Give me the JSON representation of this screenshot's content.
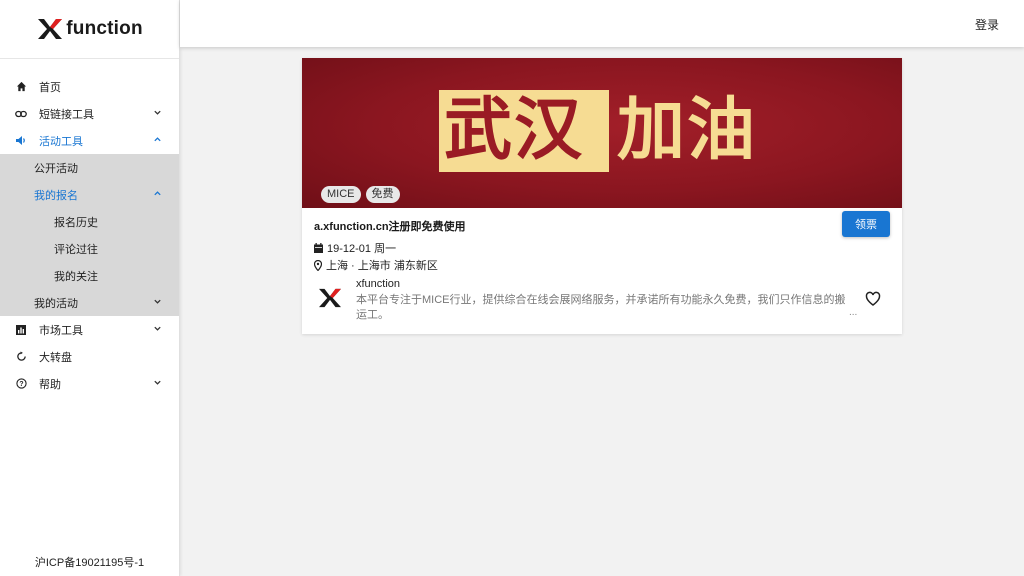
{
  "brand": {
    "name": "function"
  },
  "header": {
    "login": "登录"
  },
  "sidebar": {
    "items": [
      {
        "label": "首页"
      },
      {
        "label": "短链接工具"
      },
      {
        "label": "活动工具"
      },
      {
        "label": "市场工具"
      },
      {
        "label": "大转盘"
      },
      {
        "label": "帮助"
      }
    ],
    "activity_sub": {
      "public": "公开活动",
      "my_signup": "我的报名",
      "history": "报名历史",
      "reviewed": "评论过往",
      "following": "我的关注",
      "my_activities": "我的活动"
    },
    "icp": "沪ICP备19021195号-1"
  },
  "card": {
    "banner_text_1": "武汉",
    "banner_text_2": "加油",
    "tags": [
      "MICE",
      "免费"
    ],
    "title": "a.xfunction.cn注册即免费使用",
    "button": "领票",
    "date": "19-12-01 周一",
    "location": "上海 · 上海市 浦东新区",
    "org_name": "xfunction",
    "org_desc": "本平台专注于MICE行业，提供综合在线会展网络服务，并承诺所有功能永久免费，我们只作信息的搬运工。",
    "ellipsis": "..."
  },
  "colors": {
    "accent": "#1976d2",
    "banner": "#8b1620",
    "banner_gold": "#f6dc93"
  }
}
